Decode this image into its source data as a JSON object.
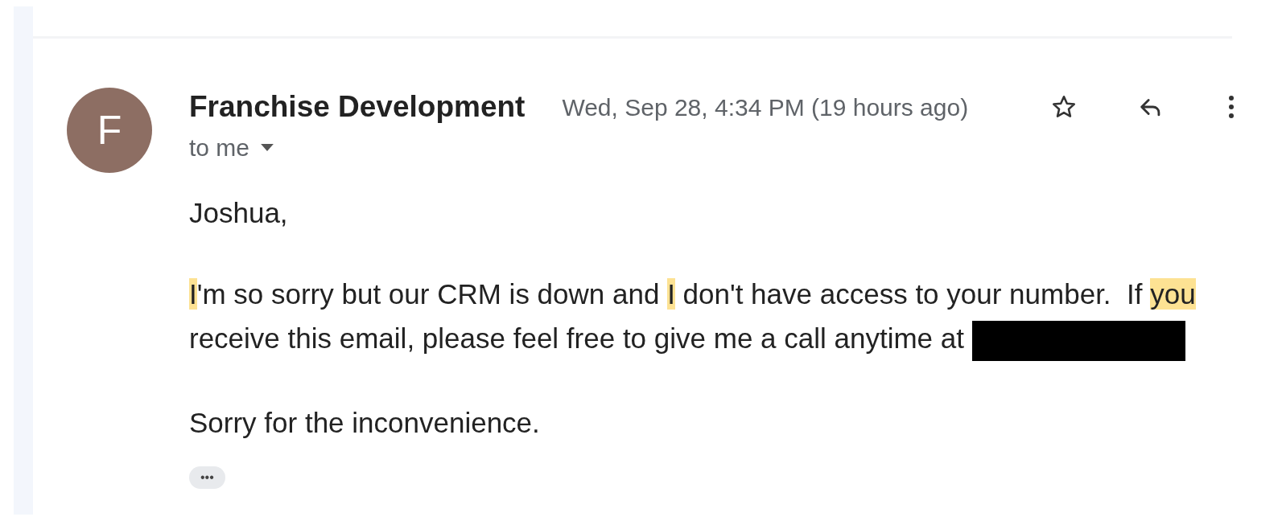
{
  "sender": {
    "initial": "F",
    "name": "Franchise Development"
  },
  "date": "Wed, Sep 28, 4:34 PM (19 hours ago)",
  "recipient": "to me",
  "body": {
    "greeting": "Joshua,",
    "paragraph": {
      "segments": [
        {
          "text": "I",
          "highlighted": true
        },
        {
          "text": "'m so sorry but our CRM is down and ",
          "highlighted": false
        },
        {
          "text": "I",
          "highlighted": true
        },
        {
          "text": " don't have access to your number.  If ",
          "highlighted": false
        },
        {
          "text": "you",
          "highlighted": true
        },
        {
          "text": " receive this email, please feel free to give me a call anytime at ",
          "highlighted": false
        }
      ],
      "redacted": true
    },
    "closing": "Sorry for the inconvenience."
  },
  "trimmed_content_button": "•••"
}
